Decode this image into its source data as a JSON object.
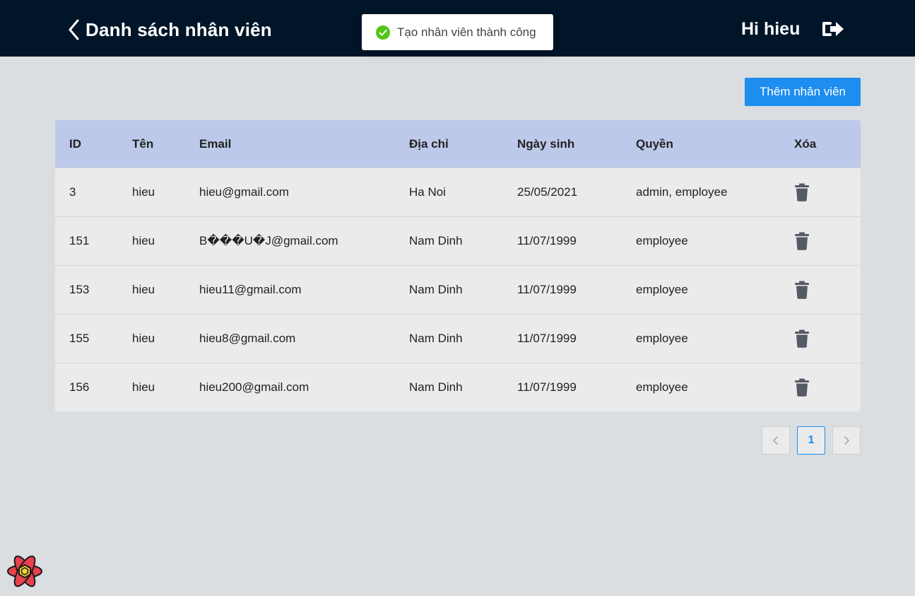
{
  "header": {
    "title": "Danh sách nhân viên",
    "greeting": "Hi hieu"
  },
  "toast": {
    "message": "Tạo nhân viên thành công"
  },
  "actions": {
    "add_label": "Thêm nhân viên"
  },
  "table": {
    "columns": [
      "ID",
      "Tên",
      "Email",
      "Địa chỉ",
      "Ngày sinh",
      "Quyền",
      "Xóa"
    ],
    "rows": [
      {
        "id": "3",
        "name": "hieu",
        "email": "hieu@gmail.com",
        "address": "Ha Noi",
        "dob": "25/05/2021",
        "role": "admin, employee"
      },
      {
        "id": "151",
        "name": "hieu",
        "email": "B���U�J@gmail.com",
        "address": "Nam Dinh",
        "dob": "11/07/1999",
        "role": "employee"
      },
      {
        "id": "153",
        "name": "hieu",
        "email": "hieu11@gmail.com",
        "address": "Nam Dinh",
        "dob": "11/07/1999",
        "role": "employee"
      },
      {
        "id": "155",
        "name": "hieu",
        "email": "hieu8@gmail.com",
        "address": "Nam Dinh",
        "dob": "11/07/1999",
        "role": "employee"
      },
      {
        "id": "156",
        "name": "hieu",
        "email": "hieu200@gmail.com",
        "address": "Nam Dinh",
        "dob": "11/07/1999",
        "role": "employee"
      }
    ]
  },
  "pagination": {
    "current_page": "1"
  },
  "icons": {
    "back": "chevron-left-icon",
    "logout": "sign-out-icon",
    "toast": "check-circle-icon",
    "delete": "trash-icon",
    "prev": "chevron-left-icon",
    "next": "chevron-right-icon",
    "devtools": "react-icon"
  },
  "colors": {
    "header_bg": "#011529",
    "page_bg": "#dadee0",
    "accent": "#1d8df0",
    "table_header_bg": "#bdc9ea",
    "row_bg": "#ebebeb",
    "success": "#52c41a",
    "trash": "#555a66"
  }
}
